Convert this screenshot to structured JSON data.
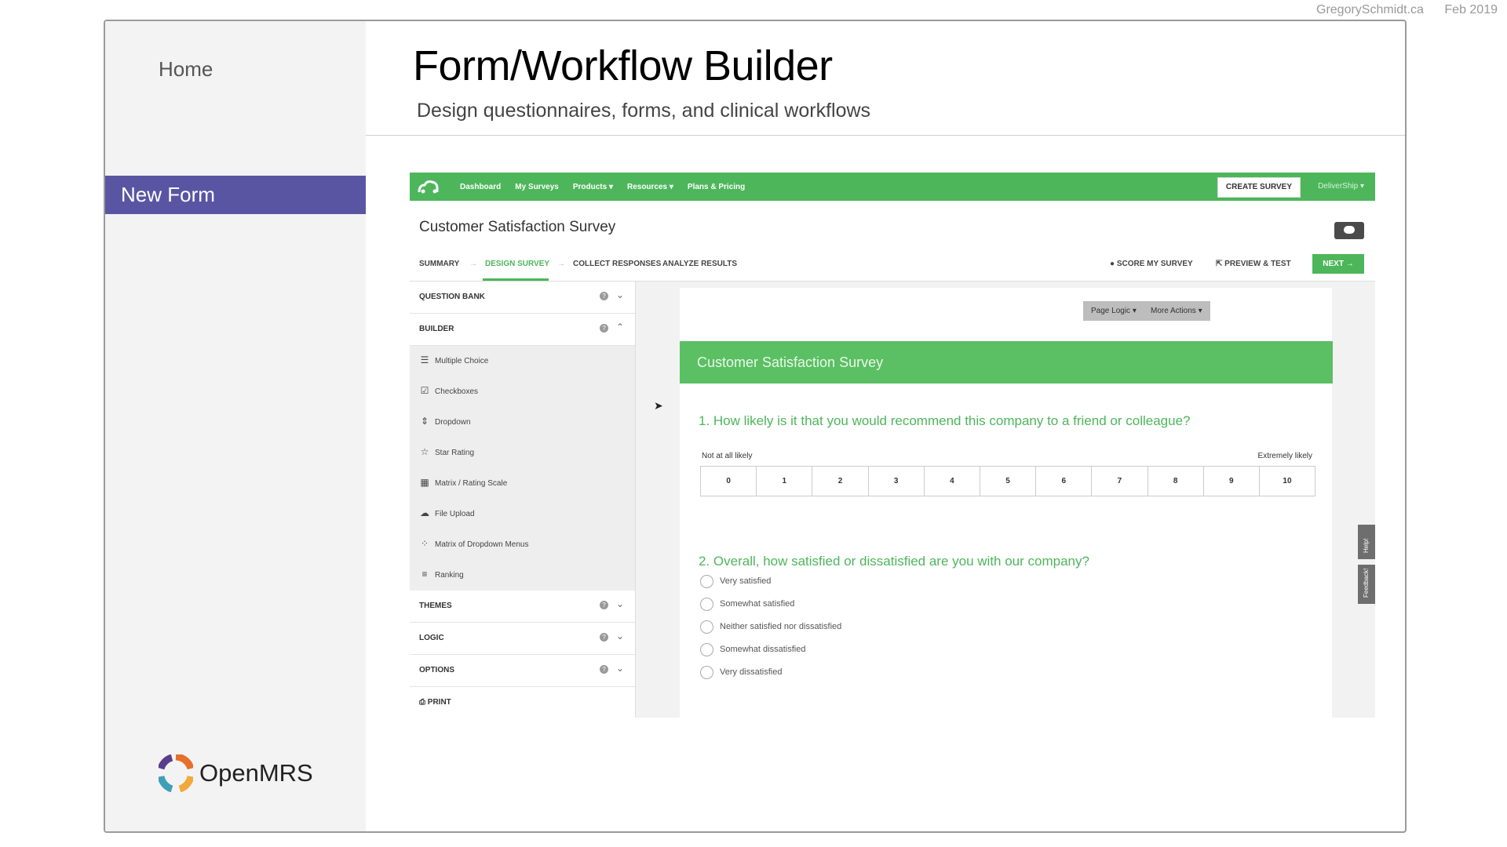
{
  "credit": {
    "site": "GregorySchmidt.ca",
    "date": "Feb 2019"
  },
  "sidebar": {
    "home": "Home",
    "active_item": "New Form",
    "logo_text": "OpenMRS"
  },
  "header": {
    "title": "Form/Workflow Builder",
    "subtitle": "Design questionnaires, forms, and clinical workflows"
  },
  "shot": {
    "nav": [
      "Dashboard",
      "My Surveys",
      "Products ▾",
      "Resources ▾",
      "Plans & Pricing"
    ],
    "create_survey": "CREATE SURVEY",
    "user_menu": "DeliverShip ▾",
    "survey_title": "Customer Satisfaction Survey",
    "steps": [
      "SUMMARY",
      "DESIGN SURVEY",
      "COLLECT RESPONSES",
      "ANALYZE RESULTS"
    ],
    "active_step": "DESIGN SURVEY",
    "score": "SCORE MY SURVEY",
    "preview": "PREVIEW & TEST",
    "next": "NEXT →",
    "panel": {
      "question_bank": "QUESTION BANK",
      "builder": "BUILDER",
      "builder_items": [
        {
          "icon": "list-icon",
          "glyph": "☰",
          "label": "Multiple Choice"
        },
        {
          "icon": "checkbox-icon",
          "glyph": "☑",
          "label": "Checkboxes"
        },
        {
          "icon": "dropdown-icon",
          "glyph": "⇕",
          "label": "Dropdown"
        },
        {
          "icon": "star-icon",
          "glyph": "☆",
          "label": "Star Rating"
        },
        {
          "icon": "grid-icon",
          "glyph": "▦",
          "label": "Matrix / Rating Scale"
        },
        {
          "icon": "upload-icon",
          "glyph": "☁",
          "label": "File Upload"
        },
        {
          "icon": "matrix-dropdown-icon",
          "glyph": "⁘",
          "label": "Matrix of Dropdown Menus"
        },
        {
          "icon": "ranking-icon",
          "glyph": "≡",
          "label": "Ranking"
        }
      ],
      "themes": "THEMES",
      "logic": "LOGIC",
      "options": "OPTIONS",
      "print": "PRINT"
    },
    "page_logic": "Page Logic ▾",
    "more_actions": "More Actions ▾",
    "survey_header": "Customer Satisfaction Survey",
    "q1": {
      "text": "1. How likely is it that you would recommend this company to a friend or colleague?",
      "low": "Not at all likely",
      "high": "Extremely likely",
      "scale": [
        "0",
        "1",
        "2",
        "3",
        "4",
        "5",
        "6",
        "7",
        "8",
        "9",
        "10"
      ]
    },
    "q2": {
      "text": "2. Overall, how satisfied or dissatisfied are you with our company?",
      "options": [
        "Very satisfied",
        "Somewhat satisfied",
        "Neither satisfied nor dissatisfied",
        "Somewhat dissatisfied",
        "Very dissatisfied"
      ]
    },
    "help_tab": "Help!",
    "feedback_tab": "Feedback!"
  },
  "colors": {
    "accent_purple": "#5a55a3",
    "brand_green": "#4db65b"
  }
}
